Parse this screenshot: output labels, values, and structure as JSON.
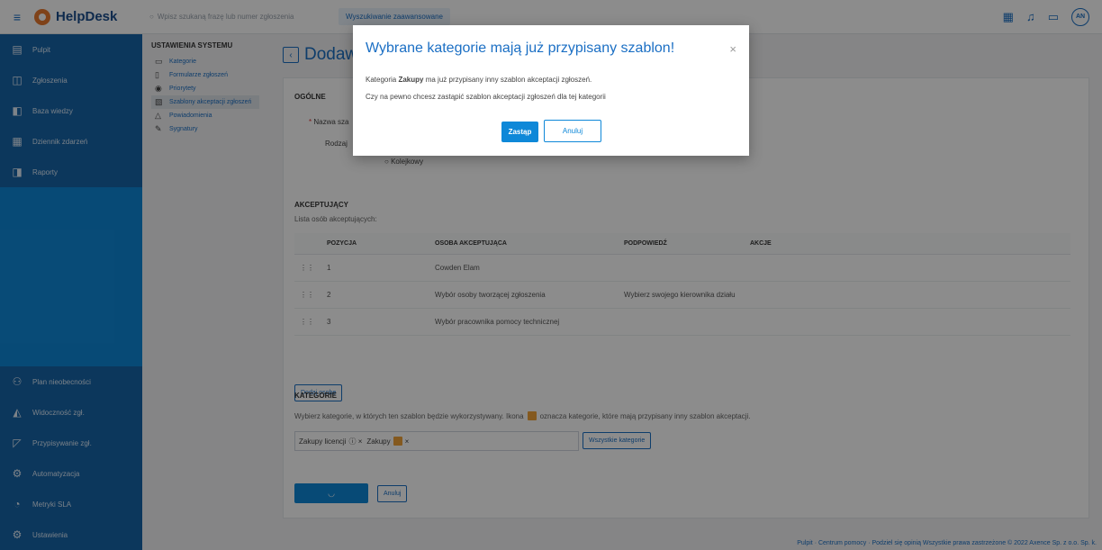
{
  "app": {
    "name": "HelpDesk",
    "avatar_initials": "AN"
  },
  "search": {
    "placeholder": "Wpisz szukaną frazę lub numer zgłoszenia",
    "advanced_label": "Wyszukiwanie zaawansowane"
  },
  "leftnav": {
    "top_items": [
      {
        "label": "Pulpit",
        "icon": "dashboard-icon"
      },
      {
        "label": "Zgłoszenia",
        "icon": "tickets-icon"
      },
      {
        "label": "Baza wiedzy",
        "icon": "book-icon"
      },
      {
        "label": "Dziennik zdarzeń",
        "icon": "calendar-icon"
      },
      {
        "label": "Raporty",
        "icon": "report-icon"
      }
    ],
    "bottom_items": [
      {
        "label": "Plan nieobecności",
        "icon": "people-icon"
      },
      {
        "label": "Widoczność zgł.",
        "icon": "visibility-icon"
      },
      {
        "label": "Przypisywanie zgł.",
        "icon": "assign-icon"
      },
      {
        "label": "Automatyzacja",
        "icon": "automation-icon"
      },
      {
        "label": "Metryki SLA",
        "icon": "sla-icon"
      },
      {
        "label": "Ustawienia",
        "icon": "gear-icon"
      }
    ]
  },
  "subnav": {
    "heading": "USTAWIENIA SYSTEMU",
    "items": [
      {
        "label": "Kategorie",
        "icon": "folder-icon"
      },
      {
        "label": "Formularze zgłoszeń",
        "icon": "form-icon"
      },
      {
        "label": "Priorytety",
        "icon": "priority-icon"
      },
      {
        "label": "Szablony akceptacji zgłoszeń",
        "icon": "template-icon",
        "active": true
      },
      {
        "label": "Powiadomienia",
        "icon": "bell-icon"
      },
      {
        "label": "Sygnatury",
        "icon": "signature-icon"
      }
    ]
  },
  "page": {
    "title": "Dodaw"
  },
  "form": {
    "general_heading": "OGÓLNE",
    "name_label": "Nazwa sza",
    "type_label": "Rodzaj",
    "type_option": "Kolejkowy"
  },
  "approvers": {
    "heading": "AKCEPTUJĄCY",
    "subheading": "Lista osób akceptujących:",
    "columns": [
      "POZYCJA",
      "OSOBA AKCEPTUJĄCA",
      "PODPOWIEDŹ",
      "AKCJE"
    ],
    "rows": [
      {
        "position": "1",
        "person": "Cowden Elam",
        "hint": ""
      },
      {
        "position": "2",
        "person": "Wybór osoby tworzącej zgłoszenia",
        "hint": "Wybierz swojego kierownika działu"
      },
      {
        "position": "3",
        "person": "Wybór pracownika pomocy technicznej",
        "hint": ""
      }
    ],
    "add_person": "Dodaj osobę"
  },
  "categories": {
    "heading": "KATEGORIE",
    "description": "Wybierz kategorie, w których ten szablon będzie wykorzystywany. Ikona",
    "description_tail": "oznacza kategorie, które mają przypisany inny szablon akceptacji.",
    "tags": [
      "Zakupy licencji",
      "Zakupy"
    ],
    "all_button": "Wszystkie kategorie"
  },
  "actions": {
    "cancel": "Anuluj"
  },
  "footer": {
    "text": "Pulpit  ·  Centrum pomocy  ·  Podziel się opinią   Wszystkie prawa zastrzeżone © 2022 Axence Sp. z o.o. Sp. k."
  },
  "modal": {
    "title": "Wybrane kategorie mają już przypisany szablon!",
    "line1_prefix": "Kategoria ",
    "line1_bold": "Zakupy",
    "line1_suffix": " ma już przypisany inny szablon akceptacji zgłoszeń.",
    "line2": "Czy na pewno chcesz zastąpić szablon akceptacji zgłoszeń dla tej kategorii",
    "confirm": "Zastąp",
    "cancel": "Anuluj",
    "close_symbol": "×"
  }
}
